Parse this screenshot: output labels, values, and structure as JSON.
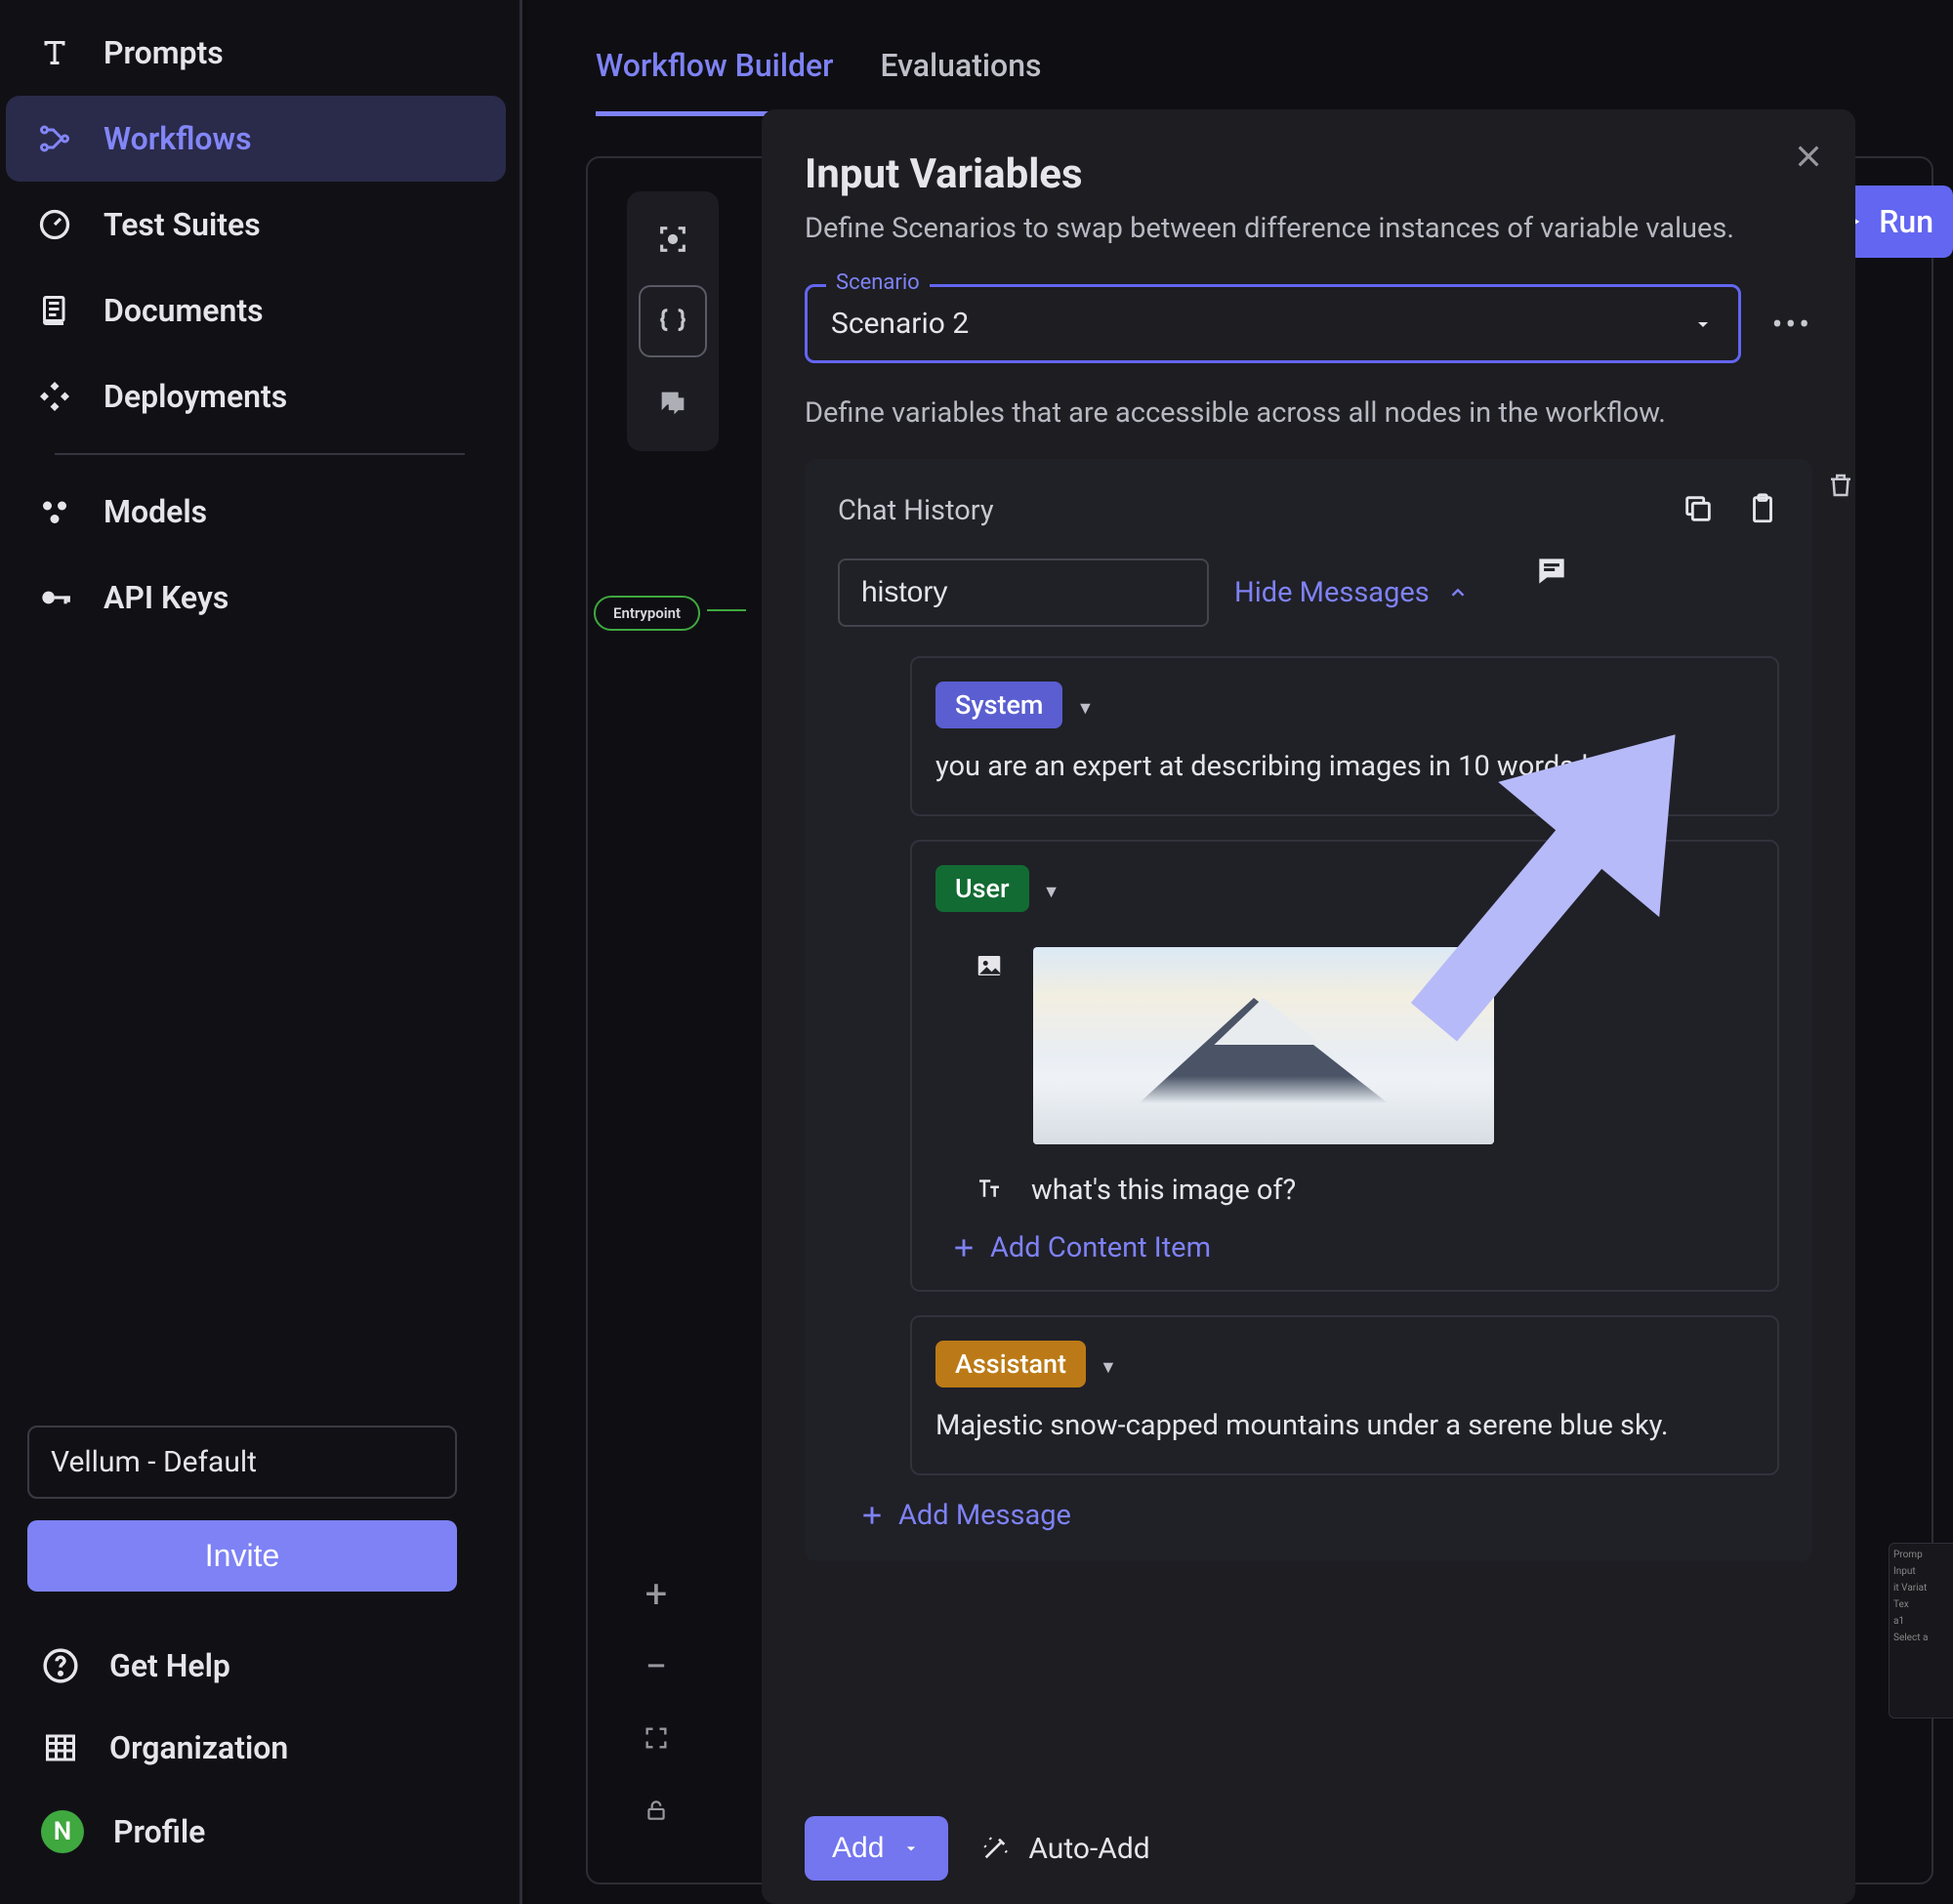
{
  "sidebar": {
    "items": [
      {
        "label": "Prompts"
      },
      {
        "label": "Workflows"
      },
      {
        "label": "Test Suites"
      },
      {
        "label": "Documents"
      },
      {
        "label": "Deployments"
      },
      {
        "label": "Models"
      },
      {
        "label": "API Keys"
      }
    ],
    "workspace": "Vellum - Default",
    "invite": "Invite",
    "bottom": {
      "help": "Get Help",
      "org": "Organization",
      "profile": "Profile",
      "avatar_initial": "N"
    }
  },
  "tabs": {
    "builder": "Workflow Builder",
    "evaluations": "Evaluations"
  },
  "run": "Run",
  "entrypoint": "Entrypoint",
  "panel": {
    "title": "Input Variables",
    "subtitle": "Define Scenarios to swap between difference instances of variable values.",
    "scenario_label": "Scenario",
    "scenario_value": "Scenario 2",
    "subtext": "Define variables that are accessible across all nodes in the workflow.",
    "card_title": "Chat History",
    "history_value": "history",
    "hide_messages": "Hide Messages",
    "roles": {
      "system": "System",
      "user": "User",
      "assistant": "Assistant"
    },
    "messages": {
      "system_text": "you are an expert at describing images in 10 words less",
      "user_prompt": "what's this image of?",
      "assistant_text": "Majestic snow-capped mountains under a serene blue sky."
    },
    "add_content": "Add Content Item",
    "add_message": "Add Message",
    "footer_add": "Add",
    "footer_auto": "Auto-Add"
  },
  "mini": {
    "l1": "Promp",
    "l2": "Input",
    "l3": "it Variat",
    "l4": "Tex",
    "l5": "a1",
    "l6": "Select a"
  }
}
